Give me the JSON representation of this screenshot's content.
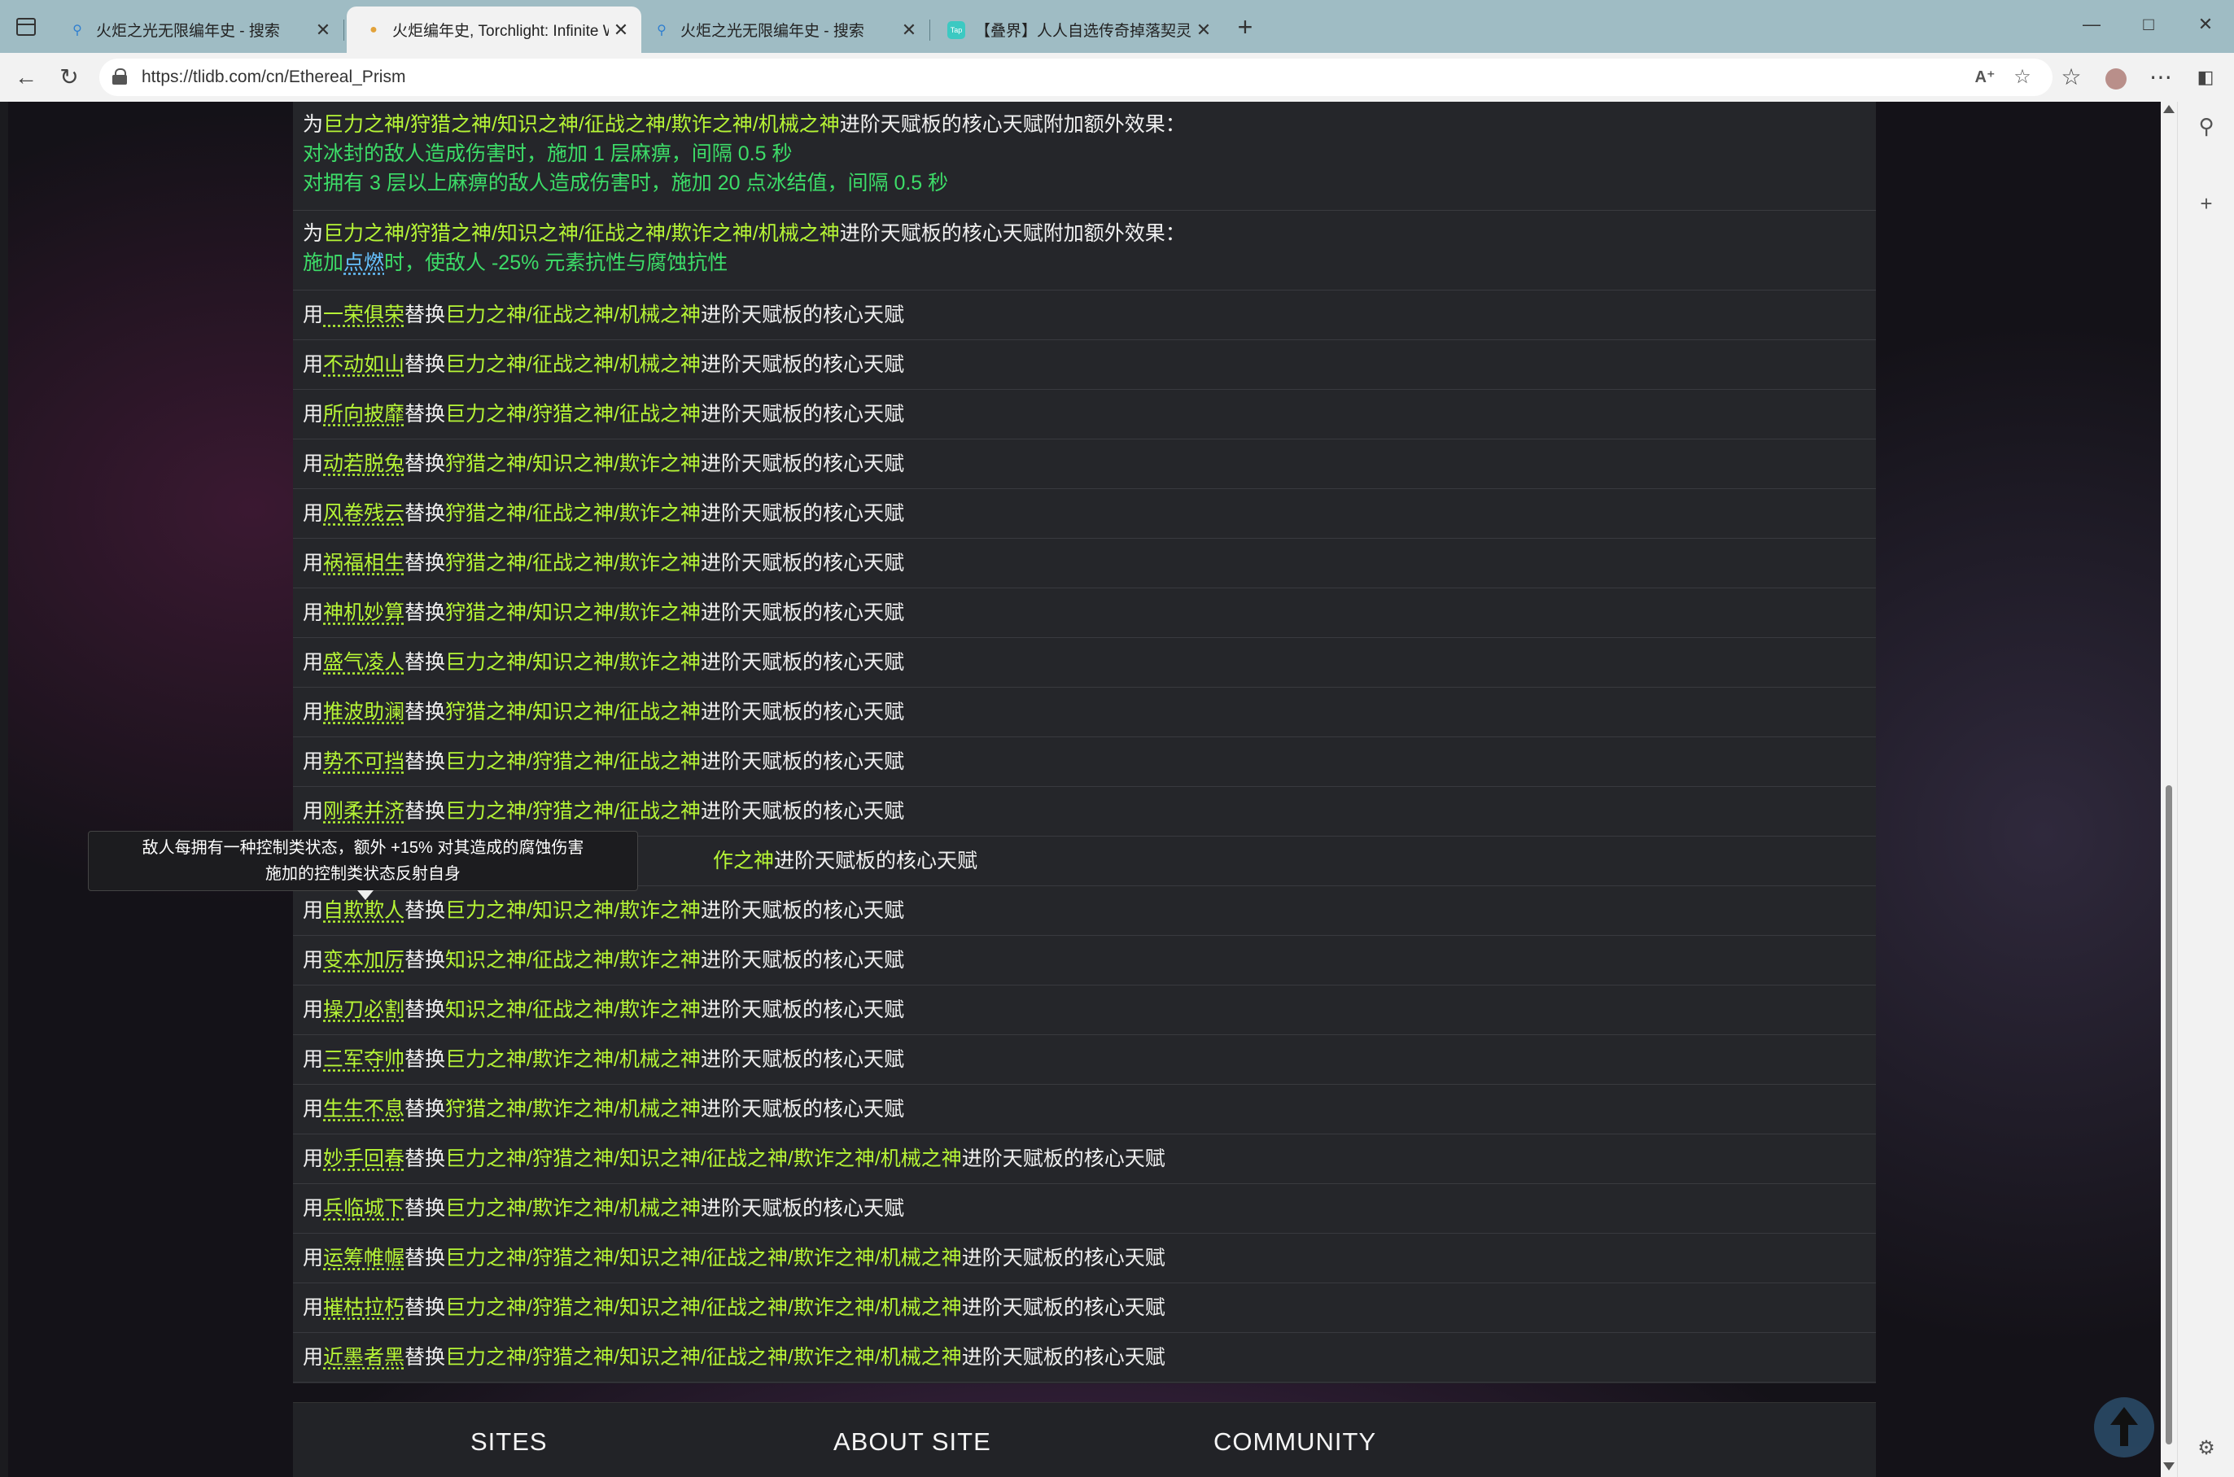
{
  "browser": {
    "tabs": [
      {
        "title": "火炬之光无限编年史 - 搜索",
        "active": false
      },
      {
        "title": "火炬编年史, Torchlight: Infinite W",
        "active": true
      },
      {
        "title": "火炬之光无限编年史 - 搜索",
        "active": false
      },
      {
        "title": "【叠界】人人自选传奇掉落契灵!",
        "active": false
      }
    ],
    "url": "https://tlidb.com/cn/Ethereal_Prism",
    "tab_favicon_label": "Tap"
  },
  "content": {
    "effect_rows": [
      {
        "prefix": "为",
        "gods": "巨力之神/狩猎之神/知识之神/征战之神/欺诈之神/机械之神",
        "suffix": "进阶天赋板的核心天赋附加额外效果：",
        "line2": "对冰封的敌人造成伤害时，施加 1 层麻痹，间隔 0.5 秒",
        "line3": "对拥有 3 层以上麻痹的敌人造成伤害时，施加 20 点冰结值，间隔 0.5 秒"
      },
      {
        "prefix": "为",
        "gods": "巨力之神/狩猎之神/知识之神/征战之神/欺诈之神/机械之神",
        "suffix": "进阶天赋板的核心天赋附加额外效果：",
        "line2a": "施加",
        "line2link": "点燃",
        "line2b": "时，使敌人 -25% 元素抗性与腐蚀抗性"
      }
    ],
    "replace_prefix": "用",
    "replace_mid": "替换",
    "replace_suffix": "进阶天赋板的核心天赋",
    "replace_rows": [
      {
        "talent": "一荣俱荣",
        "gods": "巨力之神/征战之神/机械之神"
      },
      {
        "talent": "不动如山",
        "gods": "巨力之神/征战之神/机械之神"
      },
      {
        "talent": "所向披靡",
        "gods": "巨力之神/狩猎之神/征战之神"
      },
      {
        "talent": "动若脱兔",
        "gods": "狩猎之神/知识之神/欺诈之神"
      },
      {
        "talent": "风卷残云",
        "gods": "狩猎之神/征战之神/欺诈之神"
      },
      {
        "talent": "祸福相生",
        "gods": "狩猎之神/征战之神/欺诈之神"
      },
      {
        "talent": "神机妙算",
        "gods": "狩猎之神/知识之神/欺诈之神"
      },
      {
        "talent": "盛气凌人",
        "gods": "巨力之神/知识之神/欺诈之神"
      },
      {
        "talent": "推波助澜",
        "gods": "狩猎之神/知识之神/征战之神"
      },
      {
        "talent": "势不可挡",
        "gods": "巨力之神/狩猎之神/征战之神"
      },
      {
        "talent": "刚柔并济",
        "gods": "巨力之神/狩猎之神/征战之神"
      },
      {
        "talent": "",
        "gods": "作之神",
        "partial": true
      },
      {
        "talent": "自欺欺人",
        "gods": "巨力之神/知识之神/欺诈之神"
      },
      {
        "talent": "变本加厉",
        "gods": "知识之神/征战之神/欺诈之神"
      },
      {
        "talent": "操刀必割",
        "gods": "知识之神/征战之神/欺诈之神"
      },
      {
        "talent": "三军夺帅",
        "gods": "巨力之神/欺诈之神/机械之神"
      },
      {
        "talent": "生生不息",
        "gods": "狩猎之神/欺诈之神/机械之神"
      },
      {
        "talent": "妙手回春",
        "gods": "巨力之神/狩猎之神/知识之神/征战之神/欺诈之神/机械之神"
      },
      {
        "talent": "兵临城下",
        "gods": "巨力之神/欺诈之神/机械之神"
      },
      {
        "talent": "运筹帷幄",
        "gods": "巨力之神/狩猎之神/知识之神/征战之神/欺诈之神/机械之神"
      },
      {
        "talent": "摧枯拉朽",
        "gods": "巨力之神/狩猎之神/知识之神/征战之神/欺诈之神/机械之神"
      },
      {
        "talent": "近墨者黑",
        "gods": "巨力之神/狩猎之神/知识之神/征战之神/欺诈之神/机械之神"
      }
    ]
  },
  "tooltip": {
    "line1": "敌人每拥有一种控制类状态，额外 +15% 对其造成的腐蚀伤害",
    "line2": "施加的控制类状态反射自身"
  },
  "footer": {
    "sites": "SITES",
    "about": "ABOUT SITE",
    "community": "COMMUNITY"
  },
  "icons": {
    "back": "back-arrow-icon",
    "refresh": "refresh-icon",
    "read_aloud": "read-aloud-icon",
    "favorite": "star-icon",
    "collections": "collections-icon",
    "profile": "profile-icon",
    "more": "more-icon",
    "sidebar_toggle": "sidebar-icon",
    "search": "search-icon",
    "add": "plus-icon",
    "settings": "gear-icon",
    "scroll_top": "arrow-up-icon"
  },
  "colors": {
    "god_highlight": "#b6f536",
    "effect_text": "#3ddc68",
    "link": "#66c2ff",
    "page_bg": "#25262a"
  }
}
